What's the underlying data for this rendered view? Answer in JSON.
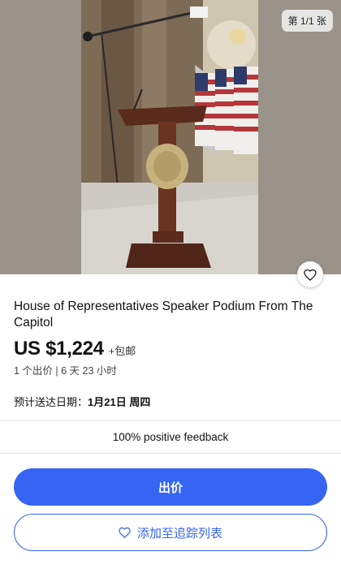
{
  "gallery": {
    "page_indicator": "第 1/1 张"
  },
  "listing": {
    "title": "House of Representatives Speaker Podium From The Capitol",
    "price": "US $1,224",
    "shipping": "+包邮",
    "bids_time": "1 个出价 | 6 天 23 小时",
    "delivery_label": "预计送达日期：",
    "delivery_date": "1月21日 周四",
    "seller_feedback": "100% positive feedback"
  },
  "actions": {
    "bid_label": "出价",
    "watch_label": "添加至追踪列表"
  },
  "colors": {
    "accent": "#3665f3"
  },
  "icons": {
    "favorite": "heart-icon",
    "watch": "heart-icon"
  }
}
